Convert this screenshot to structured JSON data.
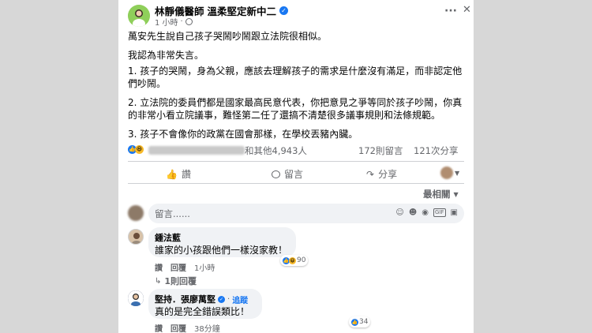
{
  "post": {
    "author": "林靜儀醫師",
    "page": "溫柔堅定新中二",
    "time": "1 小時",
    "privacy_sep": "·",
    "more": "···",
    "close": "✕",
    "paragraphs": [
      "萬安先生說自己孩子哭鬧吵鬧跟立法院很相似。",
      "我認為非常失言。",
      "1. 孩子的哭鬧，身為父親，應該去理解孩子的需求是什麼沒有滿足，而非認定他們吵鬧。",
      "2. 立法院的委員們都是國家最高民意代表，你把意見之爭等同於孩子吵鬧，你真的非常小看立院議事，難怪第二任了還搞不清楚很多議事規則和法條規範。",
      "3. 孩子不會像你的政黨在國會那樣，在學校丟豬內臟。"
    ]
  },
  "reactions": {
    "others_text": "和其他4,943人",
    "comments": "172則留言",
    "shares": "121次分享"
  },
  "actions": {
    "like": "讚",
    "comment": "留言",
    "share": "分享"
  },
  "sort": {
    "label": "最相關"
  },
  "composer": {
    "placeholder": "留言......"
  },
  "comments": [
    {
      "name": "鍾法藍",
      "text": "誰家的小孩跟他們一樣沒家教！",
      "like": "讚",
      "reply": "回覆",
      "time": "1小時",
      "reaction_count": "90",
      "replies_link": "1則回覆"
    },
    {
      "name": "堅持．張廖萬堅",
      "follow": "追蹤",
      "follow_sep": "·",
      "text": "真的是完全錯誤類比！",
      "like": "讚",
      "reply": "回覆",
      "time": "38分鐘",
      "reaction_count": "34"
    }
  ],
  "colors": {
    "accent": "#1877f2",
    "text": "#050505",
    "muted": "#65676b",
    "bubble": "#f0f2f5",
    "page_bg": "#d7d7d7"
  }
}
